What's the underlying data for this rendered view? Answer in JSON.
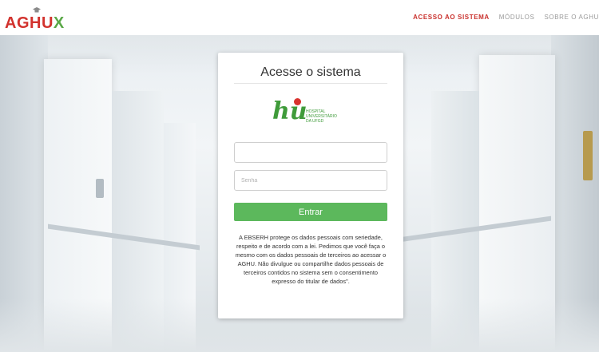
{
  "header": {
    "logo_text_main": "AGHU",
    "logo_text_accent": "X",
    "nav": [
      {
        "label": "ACESSO AO SISTEMA",
        "active": true
      },
      {
        "label": "MÓDULOS",
        "active": false
      },
      {
        "label": "SOBRE O AGHU",
        "active": false
      }
    ]
  },
  "login": {
    "title": "Acesse o sistema",
    "hospital_logo": {
      "mark": "hu",
      "lines": [
        "HOSPITAL",
        "UNIVERSITÁRIO",
        "DA UFGD"
      ]
    },
    "username": {
      "value": "",
      "placeholder": ""
    },
    "password": {
      "value": "",
      "placeholder": "Senha"
    },
    "submit_label": "Entrar",
    "notice": "A EBSERH protege os dados pessoais com seriedade, respeito e de acordo com a lei. Pedimos que você faça o mesmo com os dados pessoais de terceiros ao acessar o AGHU. Não divulgue ou compartilhe dados pessoais de terceiros contidos no sistema sem o consentimento expresso do titular de dados\"."
  },
  "colors": {
    "brand_red": "#d2322d",
    "brand_green": "#5aa847",
    "nav_active": "#c9302c",
    "button_green": "#5cb85c"
  }
}
